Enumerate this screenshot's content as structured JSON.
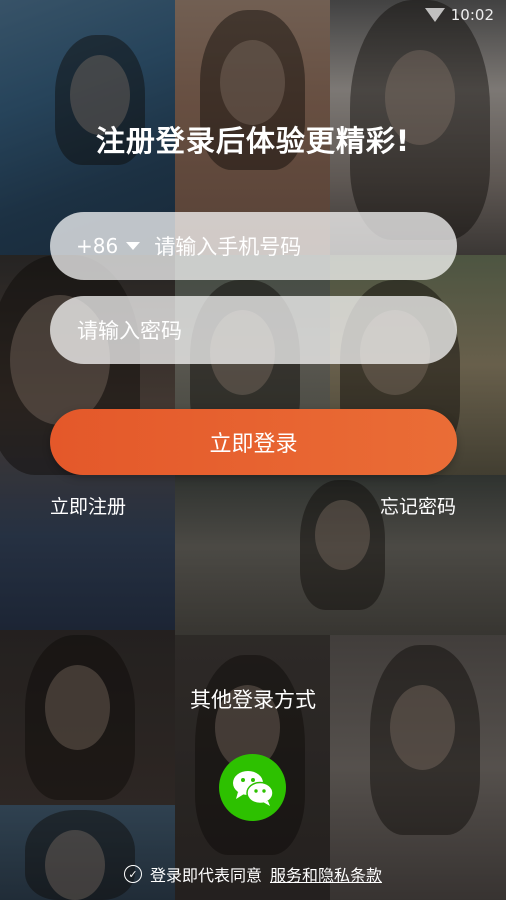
{
  "status": {
    "time": "10:02"
  },
  "title": "注册登录后体验更精彩!",
  "phone": {
    "country_code": "+86",
    "placeholder": "请输入手机号码"
  },
  "password": {
    "placeholder": "请输入密码"
  },
  "login_button": "立即登录",
  "register_link": "立即注册",
  "forgot_link": "忘记密码",
  "other_login": "其他登录方式",
  "wechat": {
    "icon": "wechat-icon",
    "color": "#2dc100"
  },
  "agreement": {
    "prefix": "登录即代表同意",
    "link": "服务和隐私条款"
  },
  "accent": "#e4582a"
}
